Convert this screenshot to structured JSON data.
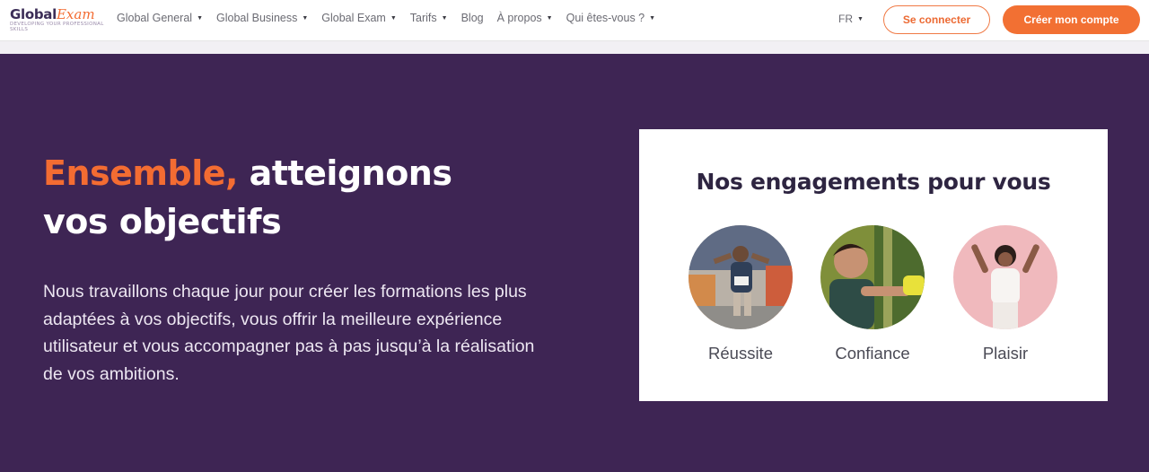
{
  "header": {
    "logo": {
      "brand": "Global",
      "script": "Exam",
      "tagline": "DEVELOPING YOUR PROFESSIONAL SKILLS"
    },
    "nav": [
      {
        "label": "Global General",
        "icon": "caret-down-icon"
      },
      {
        "label": "Global Business",
        "icon": "caret-down-icon"
      },
      {
        "label": "Global Exam",
        "icon": "caret-down-icon"
      },
      {
        "label": "Tarifs",
        "icon": "caret-down-icon"
      },
      {
        "label": "Blog"
      },
      {
        "label": "À propos",
        "icon": "caret-down-icon"
      },
      {
        "label": "Qui êtes-vous ?",
        "icon": "caret-down-icon"
      }
    ],
    "language": "FR",
    "login_label": "Se connecter",
    "signup_label": "Créer mon compte"
  },
  "hero": {
    "title_accent": "Ensemble,",
    "title_rest_1": "atteignons",
    "title_rest_2": "vos objectifs",
    "text": "Nous travaillons chaque jour pour créer les formations les plus adaptées à vos objectifs, vous offrir la meilleure expérience utilisateur et vous accompagner pas à pas jusqu’à la réalisation de vos ambitions."
  },
  "engagements": {
    "title": "Nos engagements pour vous",
    "items": [
      {
        "label": "Réussite",
        "image": "runner-crossing-finish-photo"
      },
      {
        "label": "Confiance",
        "image": "smiling-boy-outdoors-photo"
      },
      {
        "label": "Plaisir",
        "image": "woman-dancing-pink-background-photo"
      }
    ]
  },
  "colors": {
    "accent": "#f36c32",
    "hero_background": "#3e2554",
    "title_text": "#2e2541"
  }
}
